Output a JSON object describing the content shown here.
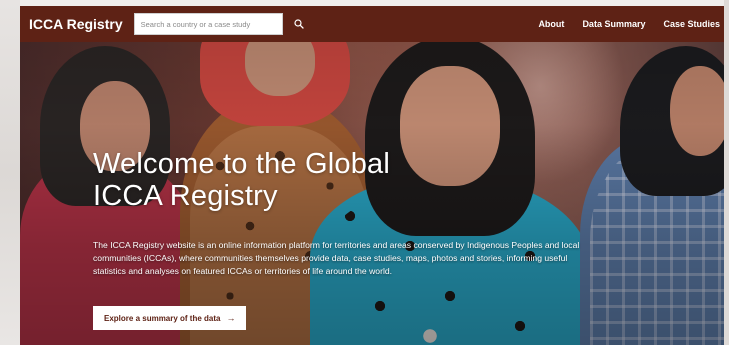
{
  "header": {
    "brand": "ICCA Registry",
    "search_placeholder": "Search a country or a case study",
    "nav": [
      {
        "label": "About"
      },
      {
        "label": "Data Summary"
      },
      {
        "label": "Case Studies"
      }
    ]
  },
  "hero": {
    "title": "Welcome to the Global ICCA Registry",
    "description": "The ICCA Registry website is an online information platform for territories and areas conserved by Indigenous Peoples and local communities (ICCAs), where communities themselves provide data, case studies, maps, photos and stories, informing useful statistics and analyses on featured ICCAs   or territories of life   around the world.",
    "cta_label": "Explore a summary of the data",
    "cta_arrow": "→"
  },
  "colors": {
    "header_bg": "#5e2215",
    "cta_text": "#5e2215",
    "text_light": "#ffffff"
  },
  "icons": {
    "search": "search-icon",
    "arrow": "arrow-right-icon"
  }
}
